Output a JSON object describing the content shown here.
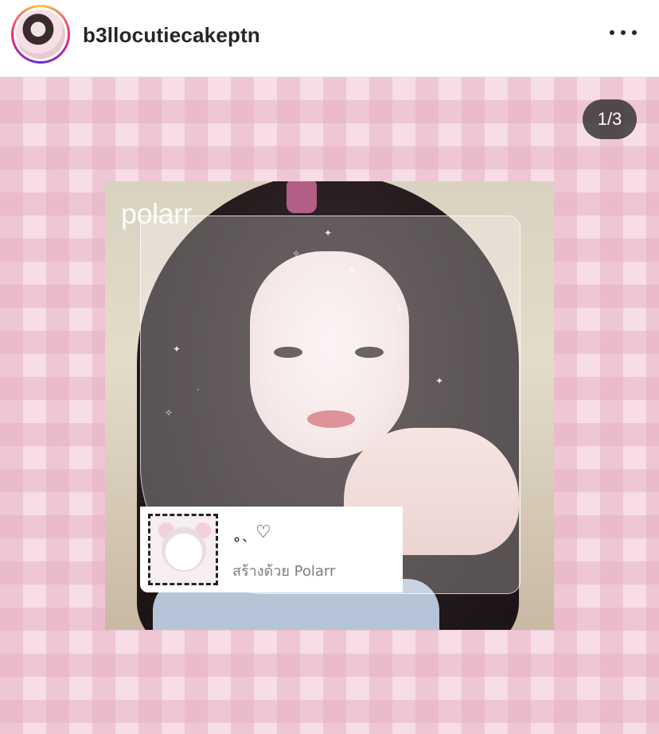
{
  "header": {
    "username": "b3llocutiecakeptn"
  },
  "post": {
    "counter": "1/3",
    "photo": {
      "watermark": "polarr",
      "caption_icons": "˳ˎ ♡",
      "caption_text": "สร้างด้วย Polarr"
    }
  },
  "colors": {
    "background_check": "#f6dde6",
    "counter_bg": "#262626"
  }
}
